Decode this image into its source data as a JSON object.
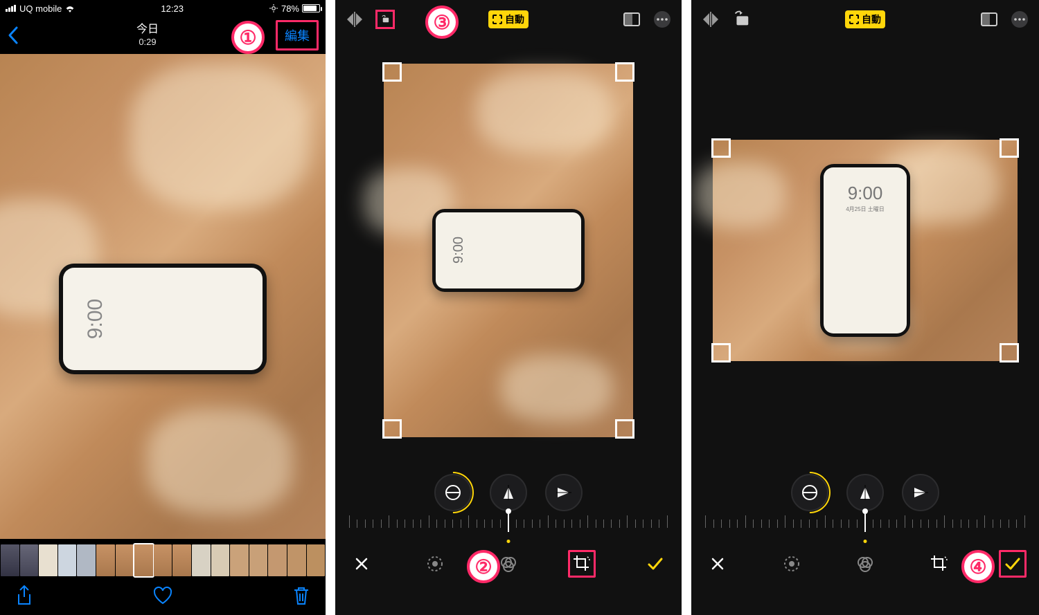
{
  "status": {
    "carrier": "UQ mobile",
    "time": "12:23",
    "battery_pct": "78%"
  },
  "nav": {
    "date": "今日",
    "subtime": "0:29",
    "edit": "編集"
  },
  "auto_label": "自動",
  "phone_clock": "9:00",
  "phone_sub": "4月25日 土曜日",
  "callouts": {
    "c1": "①",
    "c2": "②",
    "c3": "③",
    "c4": "④"
  },
  "icons": {
    "back": "back-chevron-icon",
    "share": "share-icon",
    "heart": "heart-icon",
    "trash": "trash-icon",
    "flip_h": "flip-horizontal-icon",
    "rotate": "rotate-icon",
    "aspect": "aspect-icon",
    "more": "more-icon",
    "adjust": "adjust-icon",
    "filters": "filters-icon",
    "crop": "crop-icon",
    "cancel": "cancel-icon",
    "confirm": "confirm-icon",
    "straighten": "straighten-icon",
    "persp_h": "perspective-h-icon",
    "persp_v": "perspective-v-icon"
  }
}
